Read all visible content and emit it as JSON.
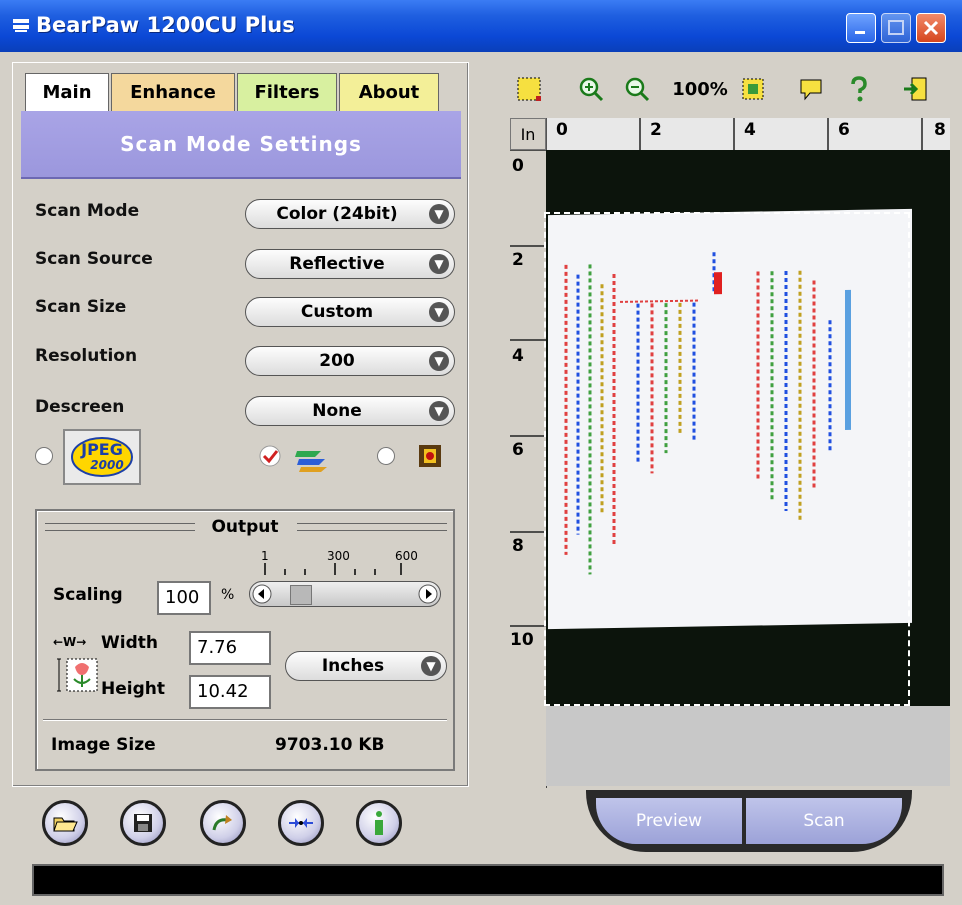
{
  "window": {
    "title": "BearPaw 1200CU Plus"
  },
  "tabs": [
    "Main",
    "Enhance",
    "Filters",
    "About"
  ],
  "active_tab": "Main",
  "section_header": "Scan Mode Settings",
  "settings": [
    {
      "label": "Scan Mode",
      "value": "Color (24bit)"
    },
    {
      "label": "Scan Source",
      "value": "Reflective"
    },
    {
      "label": "Scan Size",
      "value": "Custom"
    },
    {
      "label": "Resolution",
      "value": "200"
    },
    {
      "label": "Descreen",
      "value": "None"
    }
  ],
  "format_options": {
    "jpeg_label_top": "JPEG",
    "jpeg_label_bottom": "2000"
  },
  "output": {
    "header": "Output",
    "scaling_label": "Scaling",
    "scaling_value": "100",
    "scaling_unit": "%",
    "scale_ticks": [
      "1",
      "300",
      "600"
    ],
    "width_prefix": "←W→",
    "width_label": "Width",
    "width_value": "7.76",
    "height_label": "Height",
    "height_value": "10.42",
    "units": "Inches",
    "image_size_label": "Image Size",
    "image_size_value": "9703.10 KB"
  },
  "toolbar": {
    "zoom_label": "100%"
  },
  "ruler": {
    "unit": "In",
    "h_ticks": [
      "0",
      "2",
      "4",
      "6",
      "8"
    ],
    "v_ticks": [
      "0",
      "2",
      "4",
      "6",
      "8",
      "10"
    ]
  },
  "actions": {
    "preview": "Preview",
    "scan": "Scan"
  },
  "colors": {
    "title_bar": "#0b48d6",
    "header_band": "#a9a4e6"
  }
}
